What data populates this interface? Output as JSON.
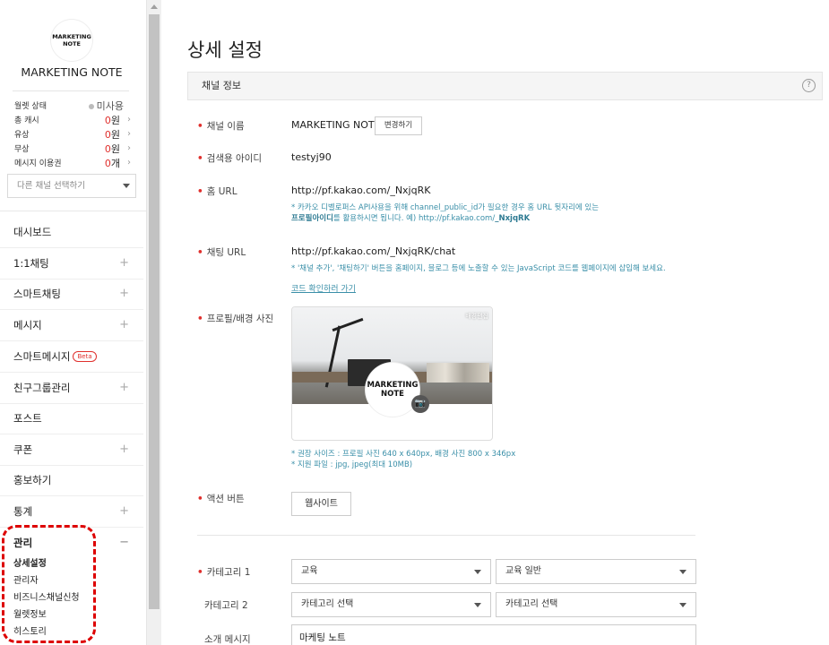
{
  "sidebar": {
    "logo_text_line1": "MARKETING",
    "logo_text_line2": "NOTE",
    "channel_name": "MARKETING NOTE",
    "wallet": {
      "status_label": "월렛 상태",
      "status_value": "미사용",
      "total_cash_label": "총 캐시",
      "total_cash_num": "0",
      "total_cash_unit": "원",
      "paid_label": "유상",
      "paid_num": "0",
      "paid_unit": "원",
      "free_label": "무상",
      "free_num": "0",
      "free_unit": "원",
      "msg_label": "메시지 이용권",
      "msg_num": "0",
      "msg_unit": "개"
    },
    "channel_select_placeholder": "다른 채널 선택하기",
    "menu": [
      {
        "label": "대시보드"
      },
      {
        "label": "1:1채팅"
      },
      {
        "label": "스마트채팅"
      },
      {
        "label": "메시지"
      },
      {
        "label": "스마트메시지",
        "badge": "Beta"
      },
      {
        "label": "친구그룹관리"
      },
      {
        "label": "포스트"
      },
      {
        "label": "쿠폰"
      },
      {
        "label": "홍보하기"
      },
      {
        "label": "통계"
      },
      {
        "label": "관리"
      }
    ],
    "plus_icon": "+",
    "minus_icon": "−",
    "submenu": [
      {
        "label": "상세설정"
      },
      {
        "label": "관리자"
      },
      {
        "label": "비즈니스채널신청"
      },
      {
        "label": "월렛정보"
      },
      {
        "label": "히스토리"
      }
    ]
  },
  "main": {
    "title": "상세 설정",
    "section_title": "채널 정보",
    "help_icon": "?",
    "required_mark": "•",
    "channel_name_label": "채널 이름",
    "channel_name_value": "MARKETING NOTE",
    "change_button": "변경하기",
    "search_id_label": "검색용 아이디",
    "search_id_value": "testyj90",
    "home_url_label": "홈 URL",
    "home_url_value": "http://pf.kakao.com/_NxjqRK",
    "home_url_note1": "* 카카오 디벨로퍼스 API사용을 위해 channel_public_id가 필요한 경우 홈 URL 뒷자리에 있는",
    "home_url_note2_bold": "프로필아이디",
    "home_url_note2_rest": "를 활용하시면 됩니다. 예) http://pf.kakao.com/",
    "home_url_note2_id": "_NxjqRK",
    "chat_url_label": "채팅 URL",
    "chat_url_value": "http://pf.kakao.com/_NxjqRK/chat",
    "chat_url_note": "* '채널 추가', '채팅하기' 버튼을 홈페이지, 블로그 등에 노출할 수 있는 JavaScript  코드를 웹페이지에 삽입해 보세요.",
    "code_link": "코드 확인하러 가기",
    "photo_label": "프로필/배경 사진",
    "cover_edit": "배경편집",
    "camera_icon": "📷",
    "photo_note1": "* 권장 사이즈 : 프로필 사진 640 x 640px, 배경 사진 800 x 346px",
    "photo_note2": "* 지원 파일 : jpg, jpeg(최대 10MB)",
    "action_label": "액션 버튼",
    "action_button": "웹사이트",
    "category1_label": "카테고리 1",
    "category1_value": "교육",
    "category1_sub_value": "교육 일반",
    "category2_label": "카테고리 2",
    "category2_value": "카테고리 선택",
    "category2_sub_value": "카테고리 선택",
    "intro_label": "소개 메시지",
    "intro_value": "마케팅 노트"
  },
  "colors": {
    "accent_red": "#e0302d",
    "note_teal": "#3a8fa8",
    "highlight_red": "#dd0000"
  }
}
